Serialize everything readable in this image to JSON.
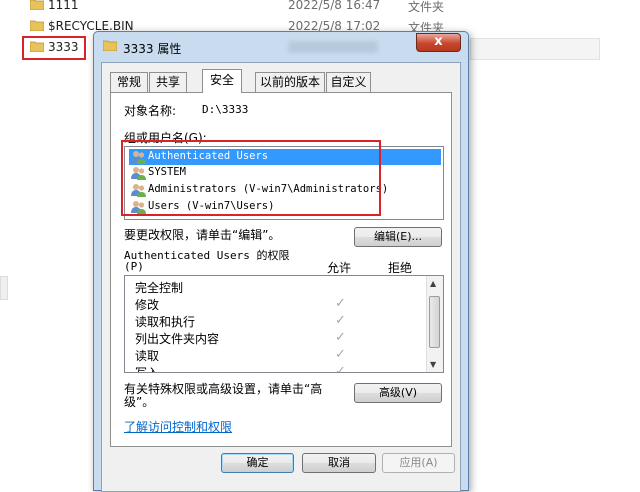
{
  "explorer": {
    "rows": [
      {
        "name": "1111",
        "date": "2022/5/8 16:47",
        "type": "文件夹"
      },
      {
        "name": "$RECYCLE.BIN",
        "date": "2022/5/8 17:02",
        "type": "文件夹"
      },
      {
        "name": "3333",
        "date": "",
        "type": ""
      }
    ]
  },
  "dialog": {
    "title": "3333 属性",
    "close_label": "x",
    "tabs": [
      "常规",
      "共享",
      "安全",
      "以前的版本",
      "自定义"
    ],
    "active_tab": "安全",
    "object_label": "对象名称:",
    "object_value": "D:\\3333",
    "group_label": "组或用户名(G):",
    "users": [
      "Authenticated Users",
      "SYSTEM",
      "Administrators (V-win7\\Administrators)",
      "Users (V-win7\\Users)"
    ],
    "selected_user_index": 0,
    "change_hint": "要更改权限，请单击“编辑”。",
    "edit_button": "编辑(E)...",
    "perm_heading_line1": "Authenticated Users 的权限",
    "perm_heading_line2": "(P)",
    "allow_header": "允许",
    "deny_header": "拒绝",
    "permissions": [
      {
        "name": "完全控制",
        "allow": false
      },
      {
        "name": "修改",
        "allow": true
      },
      {
        "name": "读取和执行",
        "allow": true
      },
      {
        "name": "列出文件夹内容",
        "allow": true
      },
      {
        "name": "读取",
        "allow": true
      },
      {
        "name": "写入",
        "allow": true
      }
    ],
    "check_glyph": "✓",
    "advanced_hint_line1": "有关特殊权限或高级设置，请单击“高",
    "advanced_hint_line2": "级”。",
    "advanced_button": "高级(V)",
    "learn_link": "了解访问控制和权限",
    "ok_button": "确定",
    "cancel_button": "取消",
    "apply_button": "应用(A)"
  },
  "colors": {
    "highlight_red": "#d8232a",
    "selection_blue": "#3399ff",
    "folder_yellow": "#e8c25a"
  }
}
